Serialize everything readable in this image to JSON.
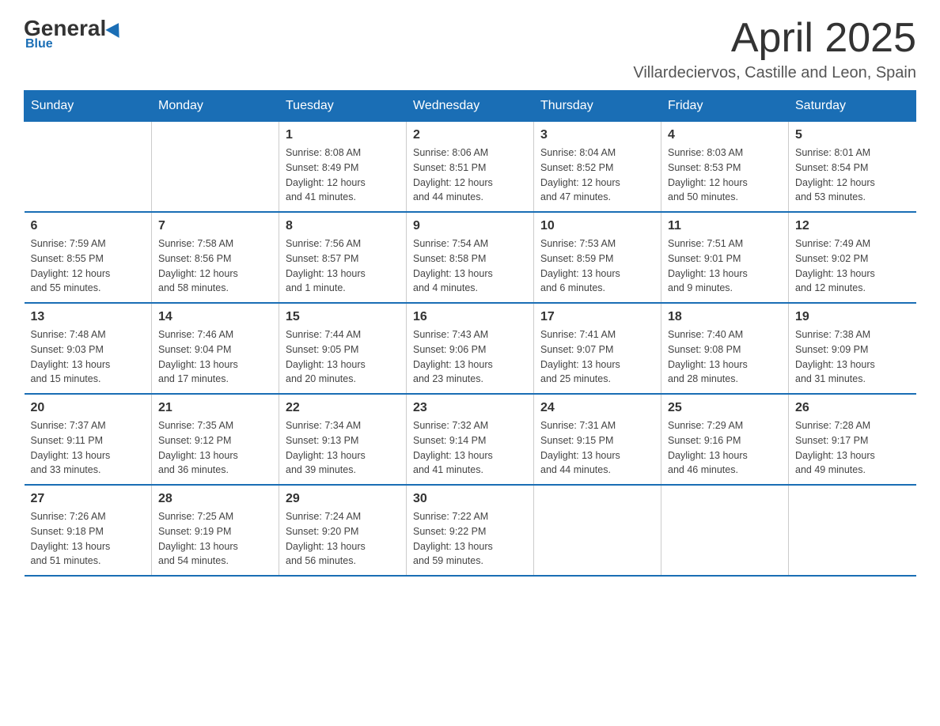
{
  "logo": {
    "general": "General",
    "blue": "Blue"
  },
  "title": {
    "month_year": "April 2025",
    "location": "Villardeciervos, Castille and Leon, Spain"
  },
  "days_of_week": [
    "Sunday",
    "Monday",
    "Tuesday",
    "Wednesday",
    "Thursday",
    "Friday",
    "Saturday"
  ],
  "weeks": [
    [
      {
        "day": "",
        "info": ""
      },
      {
        "day": "",
        "info": ""
      },
      {
        "day": "1",
        "info": "Sunrise: 8:08 AM\nSunset: 8:49 PM\nDaylight: 12 hours\nand 41 minutes."
      },
      {
        "day": "2",
        "info": "Sunrise: 8:06 AM\nSunset: 8:51 PM\nDaylight: 12 hours\nand 44 minutes."
      },
      {
        "day": "3",
        "info": "Sunrise: 8:04 AM\nSunset: 8:52 PM\nDaylight: 12 hours\nand 47 minutes."
      },
      {
        "day": "4",
        "info": "Sunrise: 8:03 AM\nSunset: 8:53 PM\nDaylight: 12 hours\nand 50 minutes."
      },
      {
        "day": "5",
        "info": "Sunrise: 8:01 AM\nSunset: 8:54 PM\nDaylight: 12 hours\nand 53 minutes."
      }
    ],
    [
      {
        "day": "6",
        "info": "Sunrise: 7:59 AM\nSunset: 8:55 PM\nDaylight: 12 hours\nand 55 minutes."
      },
      {
        "day": "7",
        "info": "Sunrise: 7:58 AM\nSunset: 8:56 PM\nDaylight: 12 hours\nand 58 minutes."
      },
      {
        "day": "8",
        "info": "Sunrise: 7:56 AM\nSunset: 8:57 PM\nDaylight: 13 hours\nand 1 minute."
      },
      {
        "day": "9",
        "info": "Sunrise: 7:54 AM\nSunset: 8:58 PM\nDaylight: 13 hours\nand 4 minutes."
      },
      {
        "day": "10",
        "info": "Sunrise: 7:53 AM\nSunset: 8:59 PM\nDaylight: 13 hours\nand 6 minutes."
      },
      {
        "day": "11",
        "info": "Sunrise: 7:51 AM\nSunset: 9:01 PM\nDaylight: 13 hours\nand 9 minutes."
      },
      {
        "day": "12",
        "info": "Sunrise: 7:49 AM\nSunset: 9:02 PM\nDaylight: 13 hours\nand 12 minutes."
      }
    ],
    [
      {
        "day": "13",
        "info": "Sunrise: 7:48 AM\nSunset: 9:03 PM\nDaylight: 13 hours\nand 15 minutes."
      },
      {
        "day": "14",
        "info": "Sunrise: 7:46 AM\nSunset: 9:04 PM\nDaylight: 13 hours\nand 17 minutes."
      },
      {
        "day": "15",
        "info": "Sunrise: 7:44 AM\nSunset: 9:05 PM\nDaylight: 13 hours\nand 20 minutes."
      },
      {
        "day": "16",
        "info": "Sunrise: 7:43 AM\nSunset: 9:06 PM\nDaylight: 13 hours\nand 23 minutes."
      },
      {
        "day": "17",
        "info": "Sunrise: 7:41 AM\nSunset: 9:07 PM\nDaylight: 13 hours\nand 25 minutes."
      },
      {
        "day": "18",
        "info": "Sunrise: 7:40 AM\nSunset: 9:08 PM\nDaylight: 13 hours\nand 28 minutes."
      },
      {
        "day": "19",
        "info": "Sunrise: 7:38 AM\nSunset: 9:09 PM\nDaylight: 13 hours\nand 31 minutes."
      }
    ],
    [
      {
        "day": "20",
        "info": "Sunrise: 7:37 AM\nSunset: 9:11 PM\nDaylight: 13 hours\nand 33 minutes."
      },
      {
        "day": "21",
        "info": "Sunrise: 7:35 AM\nSunset: 9:12 PM\nDaylight: 13 hours\nand 36 minutes."
      },
      {
        "day": "22",
        "info": "Sunrise: 7:34 AM\nSunset: 9:13 PM\nDaylight: 13 hours\nand 39 minutes."
      },
      {
        "day": "23",
        "info": "Sunrise: 7:32 AM\nSunset: 9:14 PM\nDaylight: 13 hours\nand 41 minutes."
      },
      {
        "day": "24",
        "info": "Sunrise: 7:31 AM\nSunset: 9:15 PM\nDaylight: 13 hours\nand 44 minutes."
      },
      {
        "day": "25",
        "info": "Sunrise: 7:29 AM\nSunset: 9:16 PM\nDaylight: 13 hours\nand 46 minutes."
      },
      {
        "day": "26",
        "info": "Sunrise: 7:28 AM\nSunset: 9:17 PM\nDaylight: 13 hours\nand 49 minutes."
      }
    ],
    [
      {
        "day": "27",
        "info": "Sunrise: 7:26 AM\nSunset: 9:18 PM\nDaylight: 13 hours\nand 51 minutes."
      },
      {
        "day": "28",
        "info": "Sunrise: 7:25 AM\nSunset: 9:19 PM\nDaylight: 13 hours\nand 54 minutes."
      },
      {
        "day": "29",
        "info": "Sunrise: 7:24 AM\nSunset: 9:20 PM\nDaylight: 13 hours\nand 56 minutes."
      },
      {
        "day": "30",
        "info": "Sunrise: 7:22 AM\nSunset: 9:22 PM\nDaylight: 13 hours\nand 59 minutes."
      },
      {
        "day": "",
        "info": ""
      },
      {
        "day": "",
        "info": ""
      },
      {
        "day": "",
        "info": ""
      }
    ]
  ]
}
